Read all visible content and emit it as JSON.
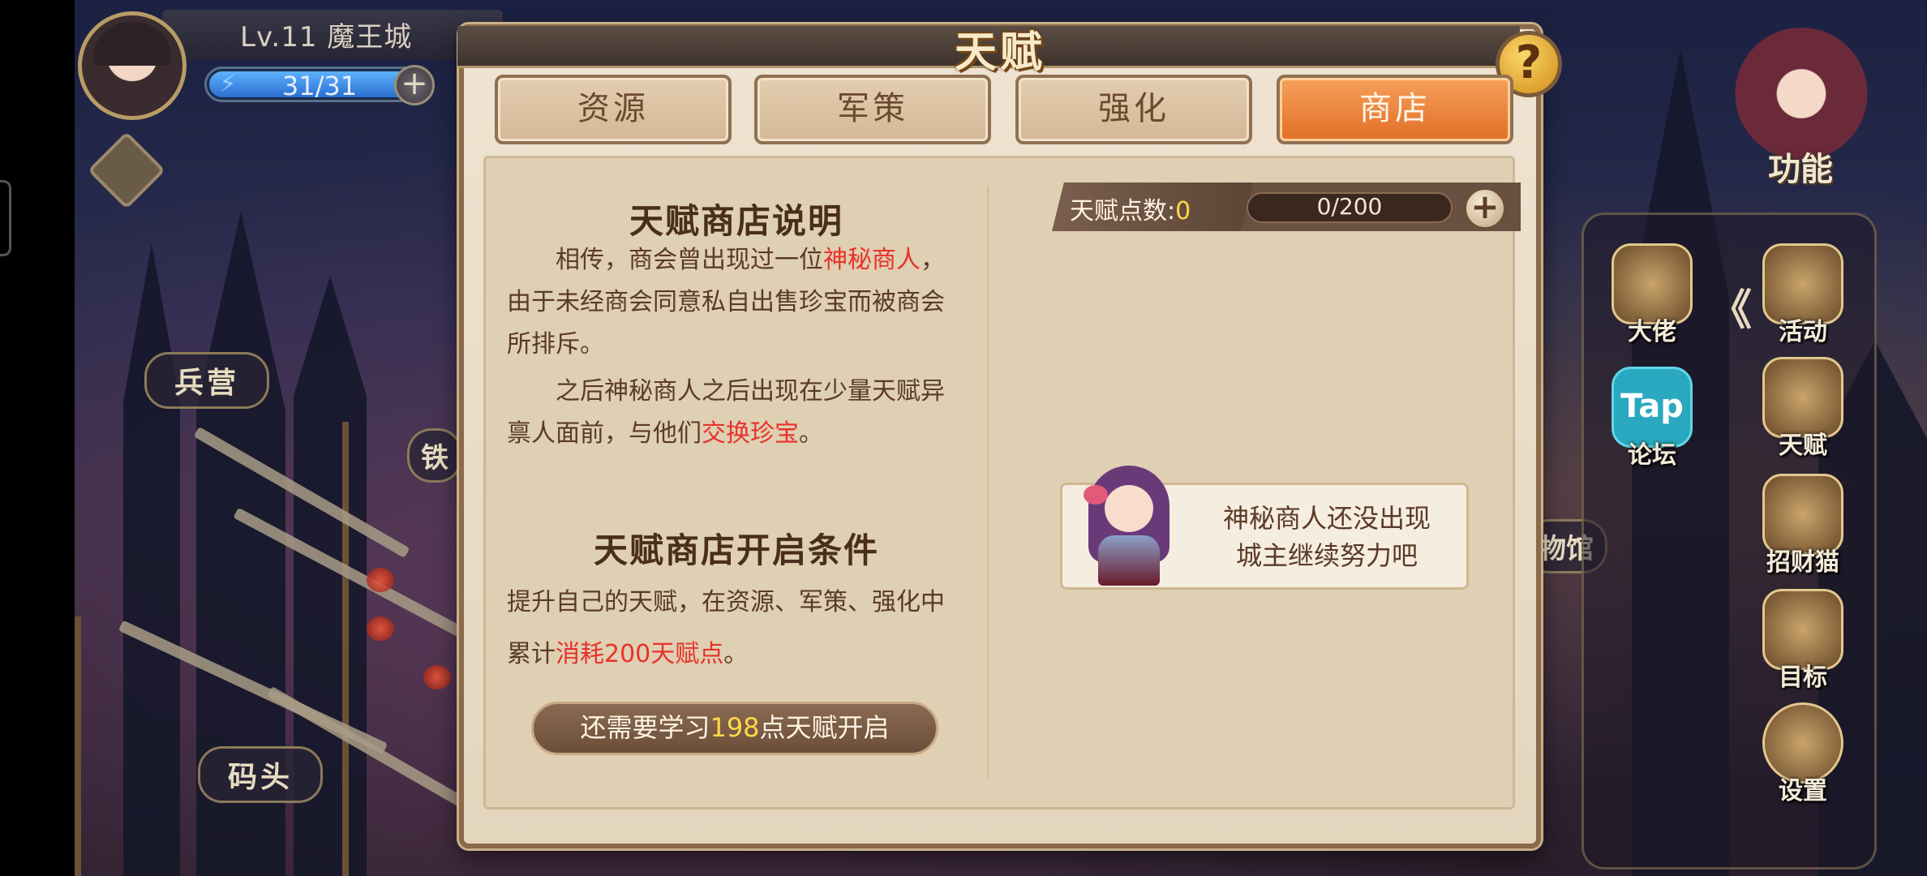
{
  "hud": {
    "level_text": "Lv.11 魔王城",
    "energy_text": "31/31",
    "energy_fraction": 1.0,
    "energy_plus": "+"
  },
  "scene": {
    "markers": [
      "兵营",
      "码头"
    ],
    "partial_markers": [
      "铁",
      "物馆"
    ]
  },
  "side_menu": {
    "function_label": "功能",
    "collapse_glyph": "《",
    "items": [
      {
        "label": "大佬",
        "icon": "crown-frog-icon"
      },
      {
        "label": "活动",
        "icon": "star-medal-icon"
      },
      {
        "label": "论坛",
        "icon": "tap-forum-icon",
        "icon_text": "Tap"
      },
      {
        "label": "天赋",
        "icon": "talent-crest-icon"
      },
      {
        "label": "招财猫",
        "icon": "lucky-cat-icon"
      },
      {
        "label": "目标",
        "icon": "target-scroll-icon"
      },
      {
        "label": "设置",
        "icon": "gear-icon"
      }
    ]
  },
  "dialog": {
    "title": "天赋",
    "help_glyph": "?",
    "tabs": [
      {
        "label": "资源",
        "active": false
      },
      {
        "label": "军策",
        "active": false
      },
      {
        "label": "强化",
        "active": false
      },
      {
        "label": "商店",
        "active": true
      }
    ],
    "left": {
      "section1_title": "天赋商店说明",
      "p1_pre": "相传，商会曾出现过一位",
      "p1_hl": "神秘商人",
      "p1_post": "，由于未经商会同意私自出售珍宝而被商会所排斥。",
      "p2_pre": "之后神秘商人之后出现在少量天赋异禀人面前，与他们",
      "p2_hl": "交换珍宝",
      "p2_post": "。",
      "section2_title": "天赋商店开启条件",
      "p3_pre": "提升自己的天赋，在资源、军策、强化中累计",
      "p3_hl": "消耗200天赋点",
      "p3_post": "。",
      "button_pre": "还需要学习",
      "button_num": "198",
      "button_post": "点天赋开启"
    },
    "right": {
      "points_label": "天赋点数:",
      "points_value": "0",
      "progress_text": "0/200",
      "plus_glyph": "+",
      "notice_line1": "神秘商人还没出现",
      "notice_line2": "城主继续努力吧"
    }
  },
  "colors": {
    "accent_orange": "#e26f26",
    "highlight_red": "#e8322a",
    "highlight_yellow": "#ffd84a",
    "dialog_bg": "#efe4d2"
  }
}
